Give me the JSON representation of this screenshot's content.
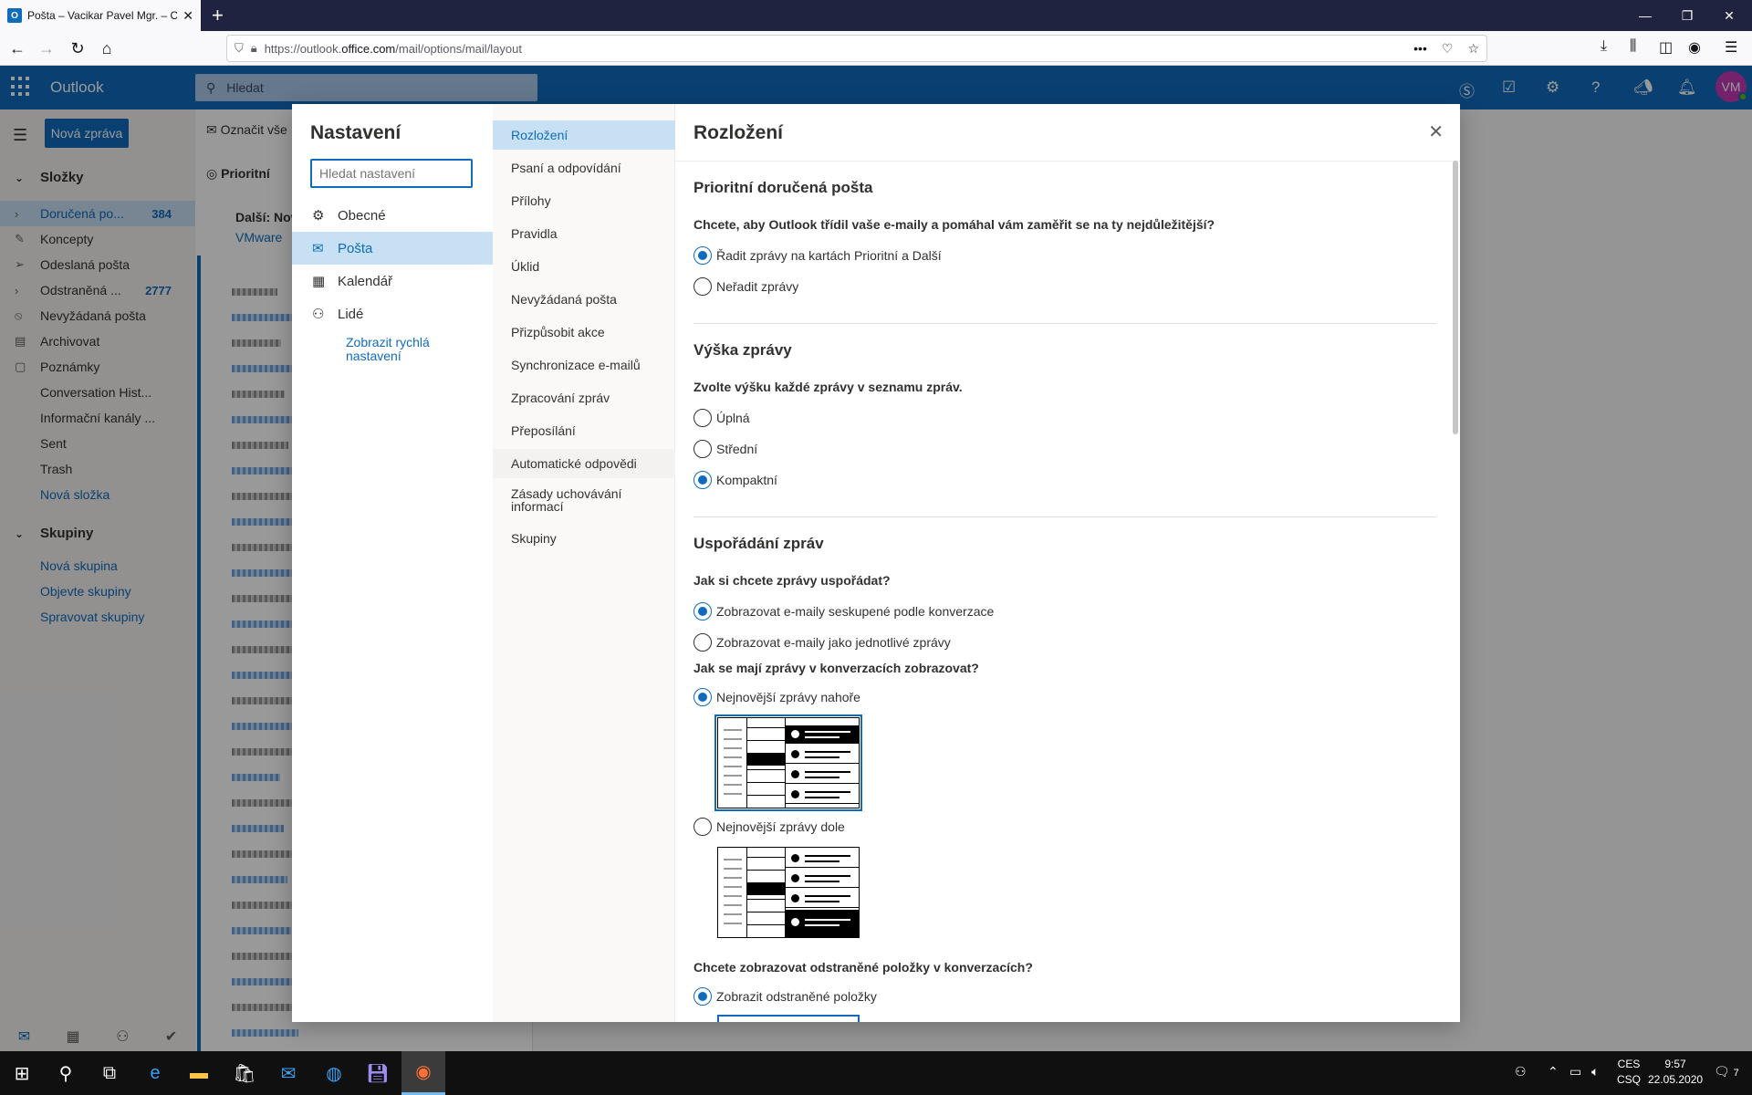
{
  "browser": {
    "tab_title": "Pošta – Vacikar Pavel Mgr. – Outlook",
    "tab_favicon": "O",
    "new_tab": "+",
    "url_prefix": "https://outlook.",
    "url_host": "office.com",
    "url_path": "/mail/options/mail/layout",
    "more": "•••"
  },
  "owa": {
    "brand": "Outlook",
    "search_placeholder": "Hledat",
    "avatar": "VM",
    "new_mail": "Nová zpráva",
    "mark_all": "Označit vše",
    "focused_tab": "Prioritní",
    "group_label": "Další: Nov",
    "group_sender": "VMware",
    "folders_header": "Složky",
    "folders": [
      {
        "label": "Doručená po...",
        "count": "384",
        "icon": "chevron-right-icon"
      },
      {
        "label": "Koncepty",
        "count": "",
        "icon": "pencil-icon"
      },
      {
        "label": "Odeslaná pošta",
        "count": "",
        "icon": "send-icon"
      },
      {
        "label": "Odstraněná ...",
        "count": "2777",
        "icon": "chevron-right-icon"
      },
      {
        "label": "Nevyžádaná pošta",
        "count": "",
        "icon": "block-icon"
      },
      {
        "label": "Archivovat",
        "count": "",
        "icon": "archive-icon"
      },
      {
        "label": "Poznámky",
        "count": "",
        "icon": "note-icon"
      },
      {
        "label": "Conversation Hist...",
        "count": "",
        "icon": ""
      },
      {
        "label": "Informační kanály ...",
        "count": "",
        "icon": ""
      },
      {
        "label": "Sent",
        "count": "",
        "icon": ""
      },
      {
        "label": "Trash",
        "count": "",
        "icon": ""
      },
      {
        "label": "Nová složka",
        "count": "",
        "icon": ""
      }
    ],
    "groups_header": "Skupiny",
    "groups": [
      "Nová skupina",
      "Objevte skupiny",
      "Spravovat skupiny"
    ]
  },
  "settings": {
    "title": "Nastavení",
    "search_placeholder": "Hledat nastavení",
    "categories": [
      {
        "label": "Obecné",
        "icon": "gear-icon"
      },
      {
        "label": "Pošta",
        "icon": "mail-icon"
      },
      {
        "label": "Kalendář",
        "icon": "calendar-icon"
      },
      {
        "label": "Lidé",
        "icon": "people-icon"
      }
    ],
    "quick_link": "Zobrazit rychlá nastavení",
    "subcategories": [
      "Rozložení",
      "Psaní a odpovídání",
      "Přílohy",
      "Pravidla",
      "Úklid",
      "Nevyžádaná pošta",
      "Přizpůsobit akce",
      "Synchronizace e-mailů",
      "Zpracování zpráv",
      "Přeposílání",
      "Automatické odpovědi",
      "Zásady uchovávání informací",
      "Skupiny"
    ]
  },
  "pane": {
    "title": "Rozložení",
    "focused_inbox": {
      "heading": "Prioritní doručená pošta",
      "question": "Chcete, aby Outlook třídil vaše e-maily a pomáhal vám zaměřit se na ty nejdůležitější?",
      "options": [
        "Řadit zprávy na kartách Prioritní a Další",
        "Neřadit zprávy"
      ],
      "selected": 0
    },
    "message_height": {
      "heading": "Výška zprávy",
      "question": "Zvolte výšku každé zprávy v seznamu zpráv.",
      "options": [
        "Úplná",
        "Střední",
        "Kompaktní"
      ],
      "selected": 2
    },
    "organization": {
      "heading": "Uspořádání zpráv",
      "question": "Jak si chcete zprávy uspořádat?",
      "options": [
        "Zobrazovat e-maily seskupené podle konverzace",
        "Zobrazovat e-maily jako jednotlivé zprávy"
      ],
      "selected": 0,
      "order_question": "Jak se mají zprávy v konverzacích zobrazovat?",
      "order_options": [
        "Nejnovější zprávy nahoře",
        "Nejnovější zprávy dole"
      ],
      "order_selected": 0,
      "deleted_question": "Chcete zobrazovat odstraněné položky v konverzacích?",
      "deleted_options": [
        "Zobrazit odstraněné položky"
      ],
      "deleted_selected": 0
    }
  },
  "taskbar": {
    "lang_top": "CES",
    "lang_bottom": "CSQ",
    "time": "9:57",
    "date": "22.05.2020",
    "notifications": "7"
  },
  "colors": {
    "accent": "#0f6cbd",
    "selection": "#c7e0f4"
  }
}
